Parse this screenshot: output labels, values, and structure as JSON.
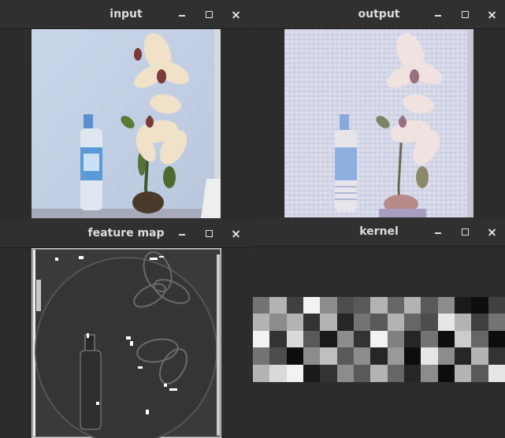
{
  "windows": {
    "input": {
      "title": "input"
    },
    "output": {
      "title": "output"
    },
    "feature_map": {
      "title": "feature map"
    },
    "kernel": {
      "title": "kernel"
    }
  },
  "kernel_grid": [
    [
      0.45,
      0.7,
      0.25,
      0.95,
      0.55,
      0.3,
      0.35,
      0.7,
      0.4,
      0.7,
      0.35,
      0.55,
      0.1,
      0.05,
      0.25
    ],
    [
      0.7,
      0.55,
      0.7,
      0.2,
      0.7,
      0.15,
      0.45,
      0.35,
      0.7,
      0.4,
      0.3,
      0.9,
      0.7,
      0.25,
      0.45
    ],
    [
      0.95,
      0.2,
      0.85,
      0.35,
      0.1,
      0.55,
      0.2,
      0.95,
      0.5,
      0.15,
      0.45,
      0.05,
      0.8,
      0.4,
      0.05
    ],
    [
      0.45,
      0.3,
      0.05,
      0.55,
      0.75,
      0.35,
      0.55,
      0.15,
      0.6,
      0.05,
      0.9,
      0.55,
      0.15,
      0.7,
      0.2
    ],
    [
      0.7,
      0.85,
      0.95,
      0.1,
      0.2,
      0.55,
      0.35,
      0.7,
      0.4,
      0.15,
      0.55,
      0.05,
      0.7,
      0.35,
      0.9
    ]
  ],
  "colors": {
    "window_bg": "#2c2c2c",
    "titlebar": "#303030",
    "title_text": "#dcdcdc"
  }
}
